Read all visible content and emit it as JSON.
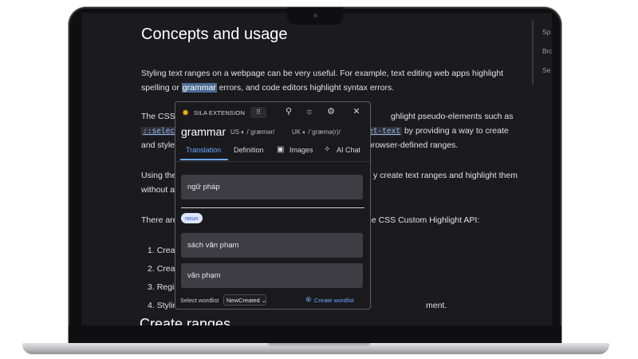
{
  "article": {
    "heading": "Concepts and usage",
    "p1_line1": "Styling text ranges on a webpage can be very useful. For example, text editing web apps highlight",
    "p1_line2_pre": "spelling or ",
    "p1_highlight": "grammar",
    "p1_line2_post": " errors, and code editors highlight syntax errors.",
    "p2_line1_start": "The CSS C",
    "p2_line1_end": "ghlight pseudo-elements such as",
    "p2_code1": "::selectio",
    "p2_code2": "et-text",
    "p2_line2_end": " by providing a way to create",
    "p2_line3_start": "and style",
    "p2_line3_end": "browser-defined ranges.",
    "p3_line1_start": "Using the",
    "p3_line1_end": "y create text ranges and highlight them",
    "p3_line2_start": "without af",
    "p4_start": "There are",
    "p4_end": "he CSS Custom Highlight API:",
    "list": [
      {
        "num": "1.",
        "text": "Creat"
      },
      {
        "num": "2.",
        "text": "Creat"
      },
      {
        "num": "3.",
        "text": "Regis"
      },
      {
        "num": "4.",
        "text": "Stylin"
      }
    ],
    "list4_end": "ment.",
    "subheading": "Create ranges"
  },
  "toc": [
    "Sp",
    "Bro",
    "Se"
  ],
  "popup": {
    "brand": "SILA EXTENSION",
    "word": "grammar",
    "us_label": "US",
    "us_ipa": "/ˈɡræmər/",
    "uk_label": "UK",
    "uk_ipa": "/ˈɡræmə(r)/",
    "tabs": [
      "Translation",
      "Definition",
      "Images",
      "AI Chat"
    ],
    "active_tab": "Translation",
    "main_translation": "ngữ pháp",
    "part_of_speech": "noun",
    "senses": [
      "sách văn phạm",
      "văn phạm"
    ],
    "select_label": "Select wordlist",
    "wordlist_value": "NewCreated",
    "create_label": "Create wordlist"
  },
  "colors": {
    "accent": "#6ea6ff",
    "popup_bg": "#1a1a1d",
    "page_bg": "#1b1b1d",
    "highlight": "#4b6a94",
    "logo": "#f2b01e"
  }
}
